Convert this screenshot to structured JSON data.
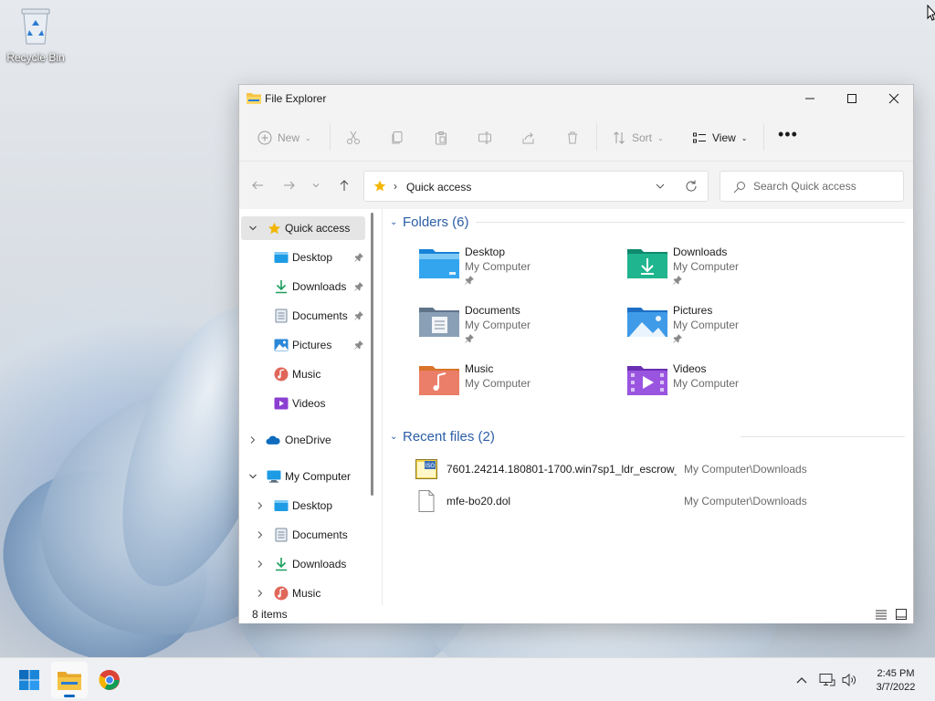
{
  "desktop": {
    "icons": [
      {
        "label": "Recycle Bin",
        "icon": "recycle-bin-icon"
      }
    ]
  },
  "window": {
    "title": "File Explorer",
    "commands": {
      "new_label": "New",
      "sort_label": "Sort",
      "view_label": "View",
      "more_label": "•••"
    },
    "address": {
      "location": "Quick access"
    },
    "search": {
      "placeholder": "Search Quick access"
    },
    "sidebar": {
      "items": [
        {
          "label": "Quick access",
          "icon": "star-icon",
          "selected": true
        },
        {
          "label": "Desktop",
          "icon": "desktop-folder-icon",
          "pinned": true
        },
        {
          "label": "Downloads",
          "icon": "download-icon",
          "pinned": true
        },
        {
          "label": "Documents",
          "icon": "documents-icon",
          "pinned": true
        },
        {
          "label": "Pictures",
          "icon": "pictures-icon",
          "pinned": true
        },
        {
          "label": "Music",
          "icon": "music-icon"
        },
        {
          "label": "Videos",
          "icon": "videos-icon"
        },
        {
          "label": "OneDrive",
          "icon": "cloud-icon"
        },
        {
          "label": "My Computer",
          "icon": "computer-icon"
        },
        {
          "label": "Desktop",
          "icon": "desktop-folder-icon"
        },
        {
          "label": "Documents",
          "icon": "documents-icon"
        },
        {
          "label": "Downloads",
          "icon": "download-icon"
        },
        {
          "label": "Music",
          "icon": "music-icon"
        }
      ]
    },
    "folders_group": {
      "title": "Folders (6)",
      "items": [
        {
          "name": "Desktop",
          "location": "My Computer",
          "pinned": true
        },
        {
          "name": "Downloads",
          "location": "My Computer",
          "pinned": true
        },
        {
          "name": "Documents",
          "location": "My Computer",
          "pinned": true
        },
        {
          "name": "Pictures",
          "location": "My Computer",
          "pinned": true
        },
        {
          "name": "Music",
          "location": "My Computer",
          "pinned": false
        },
        {
          "name": "Videos",
          "location": "My Computer",
          "pinned": false
        }
      ]
    },
    "recent_group": {
      "title": "Recent files (2)",
      "items": [
        {
          "name": "7601.24214.180801-1700.win7sp1_ldr_escrow_...",
          "location": "My Computer\\Downloads",
          "icon": "iso-file-icon"
        },
        {
          "name": "mfe-bo20.dol",
          "location": "My Computer\\Downloads",
          "icon": "file-icon"
        }
      ]
    },
    "status": {
      "item_count": "8 items"
    }
  },
  "taskbar": {
    "apps": [
      "start-icon",
      "file-explorer-icon",
      "chrome-icon"
    ],
    "clock": {
      "time": "2:45 PM",
      "date": "3/7/2022"
    }
  },
  "colors": {
    "accent": "#0067c0",
    "group_title": "#2b5ea7",
    "folder_yellow": "#f6c445"
  }
}
